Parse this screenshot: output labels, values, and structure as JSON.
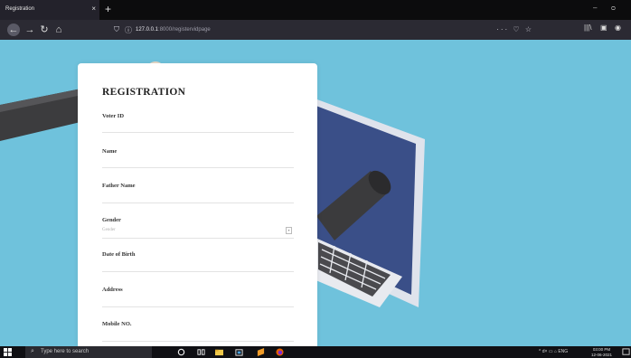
{
  "browser": {
    "tab_title": "Registration",
    "tab_close": "×",
    "new_tab": "+",
    "url_host": "127.0.0.1",
    "url_path": ":8000/registervidpage",
    "url_actions": "··· ♡ ☆",
    "minimize": "–",
    "restore": "ᴑ",
    "icons": [
      "back-arrow-icon",
      "forward-arrow-icon",
      "reload-icon",
      "home-icon",
      "library-icon",
      "sidebar-icon",
      "account-icon"
    ]
  },
  "form": {
    "title": "REGISTRATION",
    "fields": {
      "voter_id": {
        "label": "Voter ID"
      },
      "name": {
        "label": "Name"
      },
      "father_name": {
        "label": "Father Name"
      },
      "gender": {
        "label": "Gender",
        "placeholder": "Gender"
      },
      "dob": {
        "label": "Date of Birth"
      },
      "address": {
        "label": "Address"
      },
      "mobile": {
        "label": "Mobile NO."
      }
    }
  },
  "taskbar": {
    "search_placeholder": "Type here to search",
    "tray_text": "^ d× ▭ ⌂ ENG",
    "time": "03:00 PM",
    "date": "12-06-2021"
  }
}
